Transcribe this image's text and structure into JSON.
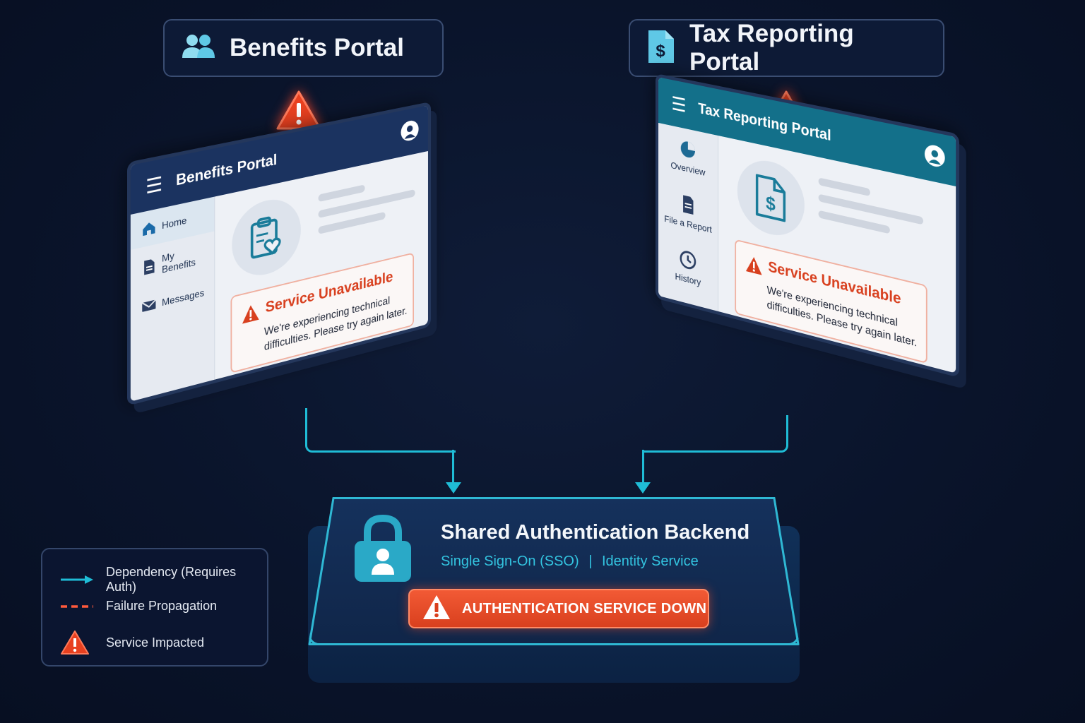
{
  "portals": {
    "benefits": {
      "label": "Benefits Portal",
      "panel_title": "Benefits Portal",
      "nav": [
        "Home",
        "My Benefits",
        "Messages"
      ],
      "error_title": "Service Unavailable",
      "error_message": "We're experiencing technical difficulties. Please try again later."
    },
    "tax": {
      "label": "Tax Reporting Portal",
      "panel_title": "Tax Reporting Portal",
      "nav": [
        "Overview",
        "File a Report",
        "History"
      ],
      "error_title": "Service Unavailable",
      "error_message": "We're experiencing technical difficulties. Please try again later."
    }
  },
  "backend": {
    "title": "Shared Authentication Backend",
    "subtitle_1": "Single Sign-On (SSO)",
    "separator": "|",
    "subtitle_2": "Identity Service",
    "status": "AUTHENTICATION SERVICE DOWN"
  },
  "legend": {
    "dependency": "Dependency (Requires Auth)",
    "failure": "Failure Propagation",
    "impacted": "Service Impacted"
  },
  "colors": {
    "background": "#0a142b",
    "dependency": "#1fbcd6",
    "failure": "#ff5a3c",
    "benefits_header": "#1b3360",
    "tax_header": "#13708a",
    "error_text": "#d8401f"
  }
}
